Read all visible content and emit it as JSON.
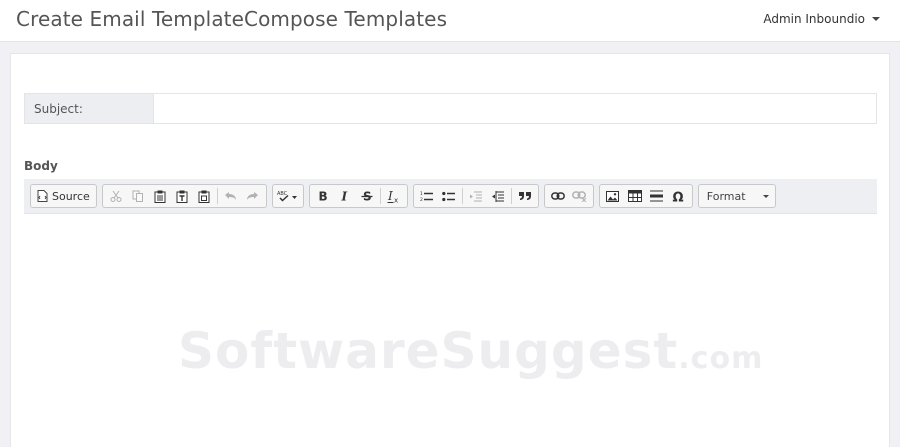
{
  "header": {
    "title": "Create Email TemplateCompose Templates",
    "user_name": "Admin Inboundio"
  },
  "form": {
    "subject_label": "Subject:",
    "subject_value": "",
    "body_label": "Body"
  },
  "toolbar": {
    "source_label": "Source",
    "format_label": "Format",
    "icons": [
      "source-icon",
      "cut-icon",
      "copy-icon",
      "paste-icon",
      "paste-text-icon",
      "paste-word-icon",
      "undo-icon",
      "redo-icon",
      "spellcheck-icon",
      "bold-icon",
      "italic-icon",
      "strike-icon",
      "remove-format-icon",
      "numbered-list-icon",
      "bulleted-list-icon",
      "outdent-icon",
      "indent-icon",
      "blockquote-icon",
      "link-icon",
      "unlink-icon",
      "image-icon",
      "table-icon",
      "horizontal-rule-icon",
      "special-char-icon"
    ]
  },
  "watermark": {
    "main": "SoftwareSuggest",
    "suffix": ".com"
  }
}
